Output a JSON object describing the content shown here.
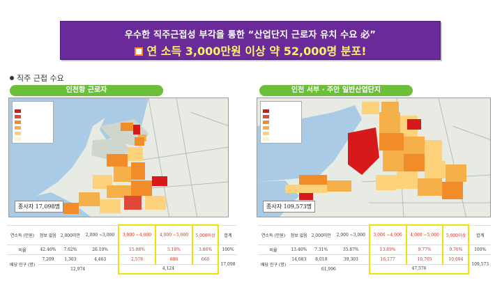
{
  "banner": {
    "line1": "우수한 직주근접성 부각을 통한 “산업단지 근로자 유치 수요 必”",
    "line2": "연 소득 3,000만원 이상 약 52,000명 분포!"
  },
  "section_title": "직주 근접 수요",
  "colors": {
    "banner_bg": "#6a2a9a",
    "banner_highlight": "#fff36a",
    "label_green": "#6cbf3a",
    "table_highlight": "#f2e200",
    "value_red": "#d92a1c"
  },
  "maps": [
    {
      "label": "인천항 근로자",
      "workers_label": "종사자 17,098명"
    },
    {
      "label": "인천 서부 · 주안 일반산업단지",
      "workers_label": "종사자 109,573명"
    }
  ],
  "tables": [
    {
      "headers": [
        "연소득 (만원)",
        "정보 없음",
        "2,000미만",
        "2,000 ~3,000",
        "3,000 ~4,000",
        "4,000 ~5,000",
        "5,000이상",
        "합계"
      ],
      "ratio_label": "비율",
      "ratio": [
        "42.46%",
        "7.62%",
        "26.10%",
        "15.08%",
        "5.18%",
        "3.86%",
        "100%"
      ],
      "pop_label": "배당 인구 (명)",
      "pop": [
        "7,209",
        "1,303",
        "4,463",
        "2,578",
        "886",
        "660"
      ],
      "total": "17,098",
      "subtotal_low": "12,974",
      "subtotal_high": "4,124"
    },
    {
      "headers": [
        "연소득 (만원)",
        "정보 없음",
        "2,000미만",
        "2,000 ~3,000",
        "3,000 ~4,000",
        "4,000 ~5,000",
        "5,000이상",
        "합계"
      ],
      "ratio_label": "비율",
      "ratio": [
        "13.40%",
        "7.31%",
        "35.87%",
        "13.89%",
        "9.77%",
        "9.76%",
        "100%"
      ],
      "pop_label": "배당 인구 (명)",
      "pop": [
        "14,683",
        "8,010",
        "39,303",
        "16,177",
        "10,705",
        "10,694"
      ],
      "total": "109,573",
      "subtotal_low": "61,996",
      "subtotal_high": "47,576"
    }
  ]
}
